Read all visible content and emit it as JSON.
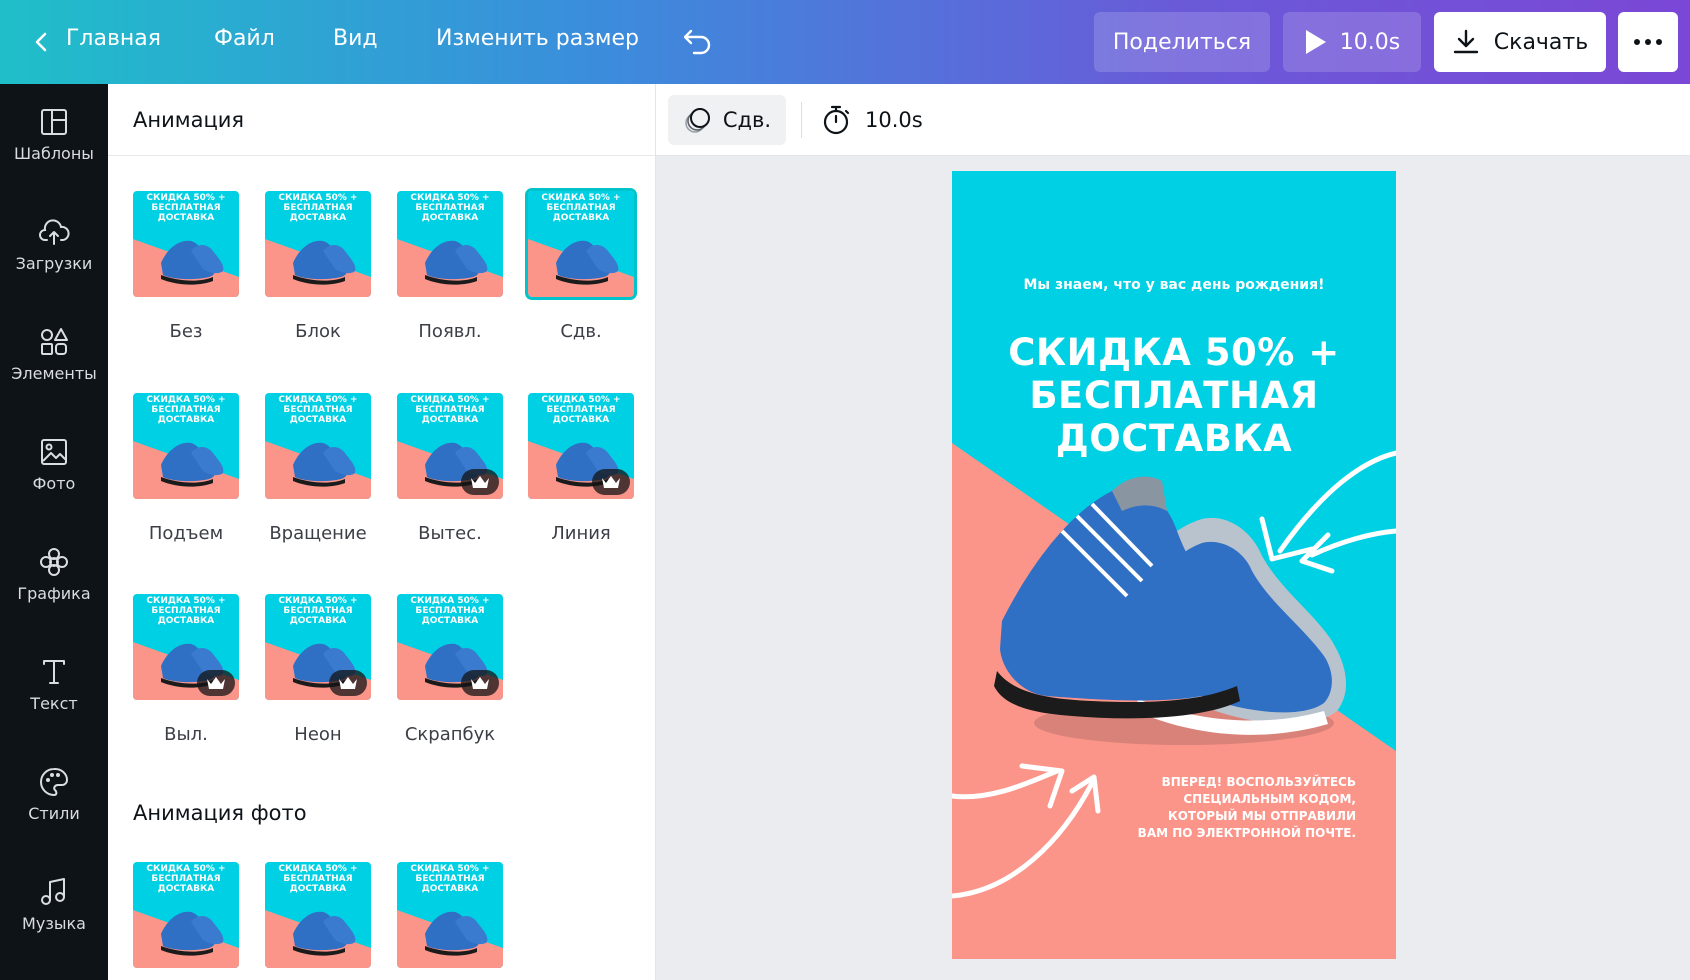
{
  "topbar": {
    "home": "Главная",
    "file": "Файл",
    "view": "Вид",
    "resize": "Изменить размер",
    "share": "Поделиться",
    "duration": "10.0s",
    "download": "Скачать"
  },
  "rail": [
    {
      "label": "Шаблоны",
      "icon": "layout-icon"
    },
    {
      "label": "Загрузки",
      "icon": "upload-cloud-icon"
    },
    {
      "label": "Элементы",
      "icon": "shapes-icon"
    },
    {
      "label": "Фото",
      "icon": "photo-icon"
    },
    {
      "label": "Графика",
      "icon": "flower-icon"
    },
    {
      "label": "Текст",
      "icon": "text-icon"
    },
    {
      "label": "Стили",
      "icon": "palette-icon"
    },
    {
      "label": "Музыка",
      "icon": "music-icon"
    }
  ],
  "panel": {
    "title": "Анимация",
    "animations": [
      {
        "label": "Без",
        "premium": false,
        "selected": false
      },
      {
        "label": "Блок",
        "premium": false,
        "selected": false
      },
      {
        "label": "Появл.",
        "premium": false,
        "selected": false
      },
      {
        "label": "Сдв.",
        "premium": false,
        "selected": true
      },
      {
        "label": "Подъем",
        "premium": false,
        "selected": false
      },
      {
        "label": "Вращение",
        "premium": false,
        "selected": false
      },
      {
        "label": "Вытес.",
        "premium": true,
        "selected": false
      },
      {
        "label": "Линия",
        "premium": true,
        "selected": false
      },
      {
        "label": "Выл.",
        "premium": true,
        "selected": false
      },
      {
        "label": "Неон",
        "premium": true,
        "selected": false
      },
      {
        "label": "Скрапбук",
        "premium": true,
        "selected": false
      }
    ],
    "photo_section_title": "Анимация фото",
    "thumb_text": "СКИДКА 50% + БЕСПЛАТНАЯ ДОСТАВКА"
  },
  "context": {
    "animation_label": "Сдв.",
    "duration": "10.0s"
  },
  "poster": {
    "subtitle": "Мы знаем, что у вас день рождения!",
    "headline_line1": "СКИДКА 50% +",
    "headline_line2": "БЕСПЛАТНАЯ",
    "headline_line3": "ДОСТАВКА",
    "footer_line1": "ВПЕРЕД! ВОСПОЛЬЗУЙТЕСЬ",
    "footer_line2": "СПЕЦИАЛЬНЫМ КОДОМ,",
    "footer_line3": "КОТОРЫЙ МЫ ОТПРАВИЛИ",
    "footer_line4": "ВАМ ПО ЭЛЕКТРОННОЙ ПОЧТЕ."
  },
  "colors": {
    "cyan": "#00d0e3",
    "salmon": "#fb958a",
    "shoe_blue": "#2f6fc4",
    "accent": "#00c4cc",
    "rail_bg": "#0e1318"
  }
}
